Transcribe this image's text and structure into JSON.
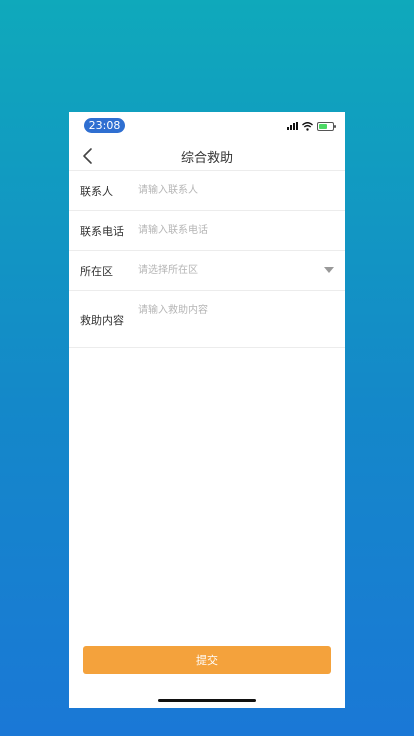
{
  "status_bar": {
    "time": "23:08"
  },
  "nav": {
    "title": "综合救助"
  },
  "form": {
    "contact": {
      "label": "联系人",
      "placeholder": "请输入联系人"
    },
    "phone": {
      "label": "联系电话",
      "placeholder": "请输入联系电话"
    },
    "district": {
      "label": "所在区",
      "placeholder": "请选择所在区"
    },
    "content": {
      "label": "救助内容",
      "placeholder": "请输入救助内容"
    }
  },
  "submit": {
    "label": "提交"
  },
  "colors": {
    "accent": "#f4a23c",
    "time_pill": "#2f6fd1",
    "battery": "#4cd964"
  }
}
